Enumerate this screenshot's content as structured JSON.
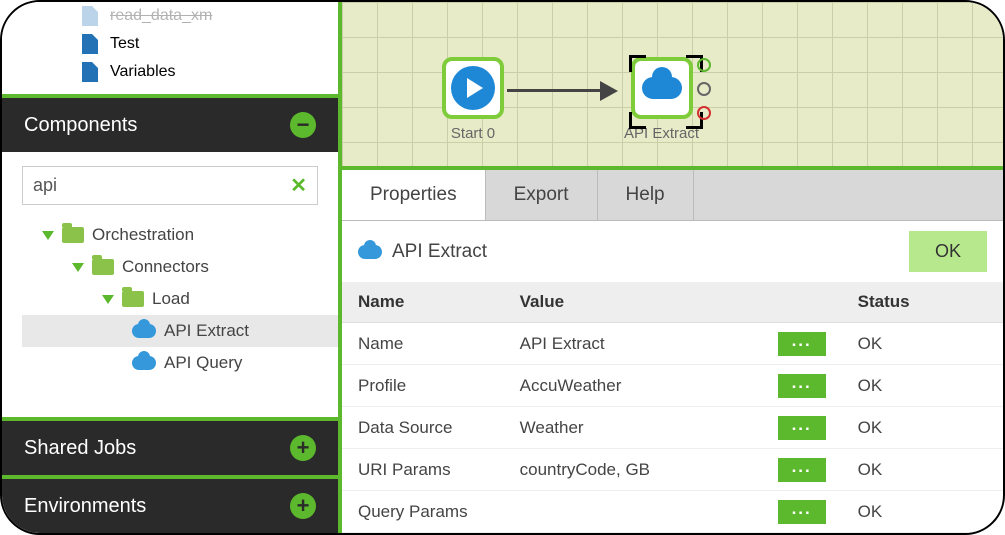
{
  "jobs": {
    "items": [
      {
        "name": "read_data_xm",
        "cut": true
      },
      {
        "name": "Test",
        "cut": false
      },
      {
        "name": "Variables",
        "cut": false
      }
    ]
  },
  "sidebar": {
    "components": {
      "title": "Components",
      "search_value": "api",
      "tree": {
        "orchestration": "Orchestration",
        "connectors": "Connectors",
        "load": "Load",
        "api_extract": "API Extract",
        "api_query": "API Query"
      }
    },
    "shared_jobs": {
      "title": "Shared Jobs"
    },
    "environments": {
      "title": "Environments"
    }
  },
  "canvas": {
    "nodes": {
      "start": {
        "label": "Start 0"
      },
      "api_extract": {
        "label": "API Extract"
      }
    }
  },
  "panel": {
    "tabs": {
      "properties": "Properties",
      "export": "Export",
      "help": "Help"
    },
    "title": "API Extract",
    "status": "OK",
    "columns": {
      "name": "Name",
      "value": "Value",
      "status": "Status"
    },
    "rows": [
      {
        "name": "Name",
        "value": "API Extract",
        "status": "OK"
      },
      {
        "name": "Profile",
        "value": "AccuWeather",
        "status": "OK"
      },
      {
        "name": "Data Source",
        "value": "Weather",
        "status": "OK"
      },
      {
        "name": "URI Params",
        "value": "countryCode, GB",
        "status": "OK"
      },
      {
        "name": "Query Params",
        "value": "",
        "status": "OK"
      }
    ],
    "edit_btn": "..."
  }
}
